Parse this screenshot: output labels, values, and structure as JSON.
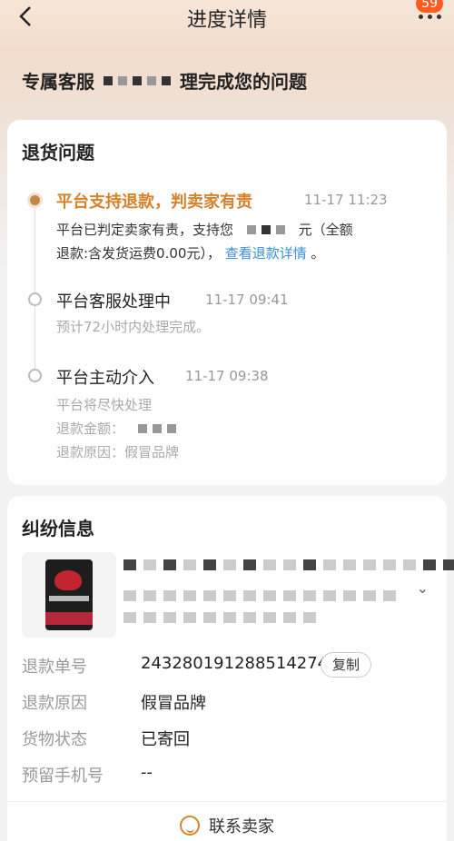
{
  "nav": {
    "title": "进度详情",
    "badge": "59"
  },
  "banner": {
    "prefix": "专属客服",
    "suffix": "理完成您的问题"
  },
  "return_issue": {
    "title": "退货问题",
    "events": [
      {
        "title": "平台支持退款，判卖家有责",
        "time": "11-17 11:23",
        "line1_a": "平台已判定卖家有责，支持您",
        "line1_b": "元（全额",
        "line2_a": "退款:含发货运费0.00元），",
        "link": "查看退款详情",
        "line2_end": "。"
      },
      {
        "title": "平台客服处理中",
        "time": "11-17 09:41",
        "sub": "预计72小时内处理完成。"
      },
      {
        "title": "平台主动介入",
        "time": "11-17 09:38",
        "sub1": "平台将尽快处理",
        "sub2": "退款金额：",
        "sub3": "退款原因：假冒品牌"
      }
    ]
  },
  "dispute": {
    "title": "纠纷信息",
    "rows": [
      {
        "label": "退款单号",
        "value": "243280191288514274"
      },
      {
        "label": "退款原因",
        "value": "假冒品牌"
      },
      {
        "label": "货物状态",
        "value": "已寄回"
      },
      {
        "label": "预留手机号",
        "value": "--"
      }
    ],
    "copy_label": "复制",
    "contact_label": "联系卖家"
  }
}
